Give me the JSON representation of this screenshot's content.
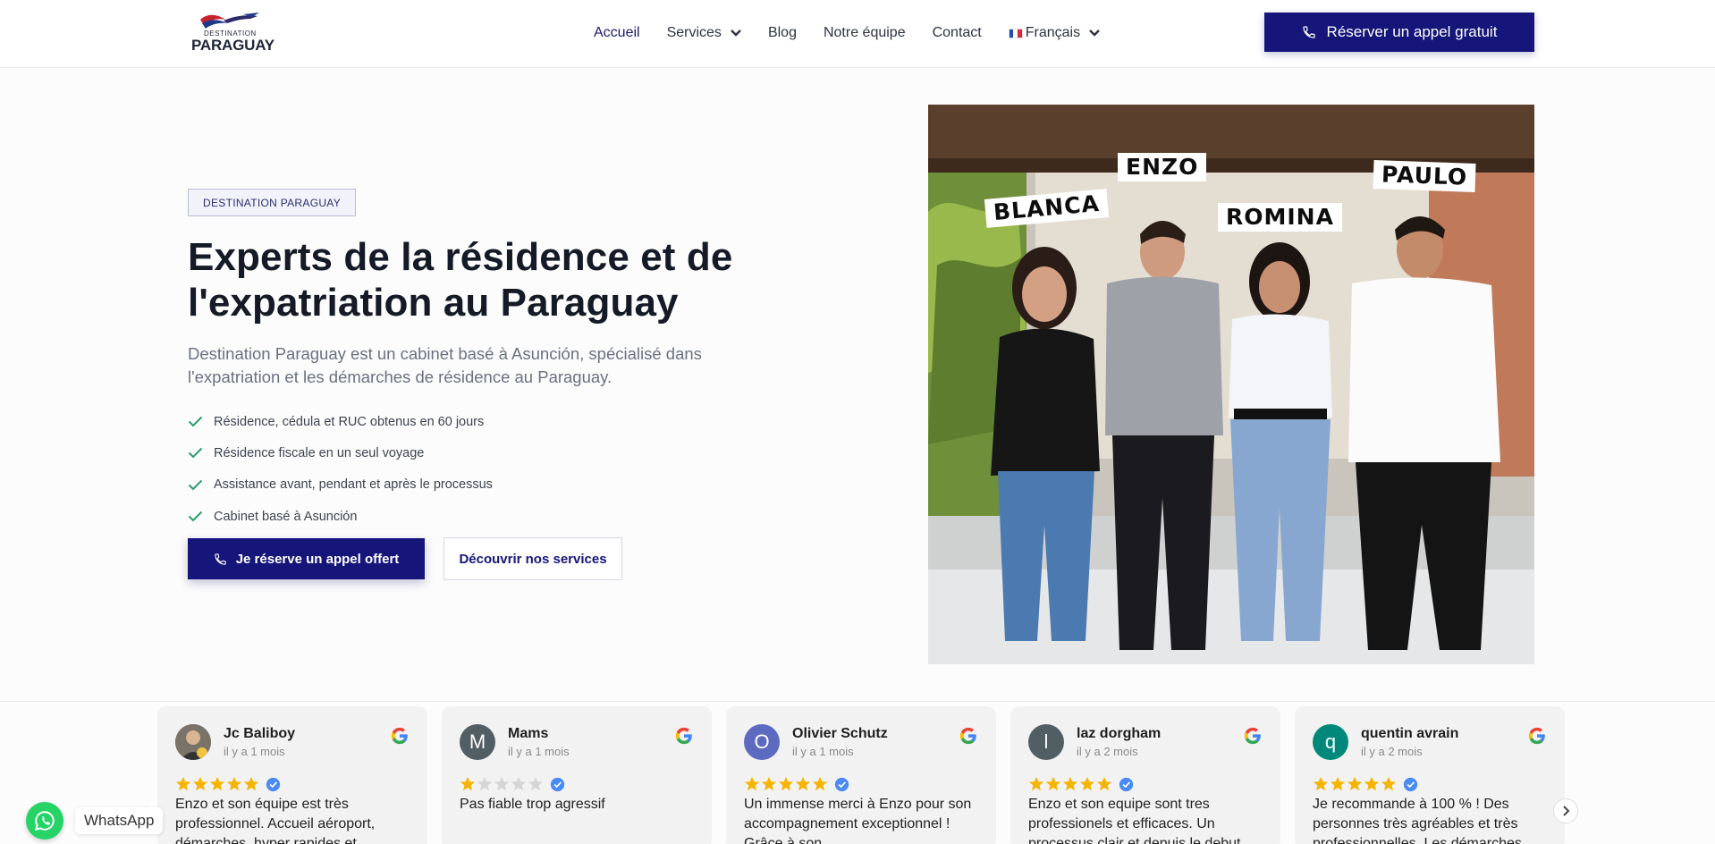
{
  "header": {
    "logo": {
      "line1": "DESTINATION",
      "line2": "PARAGUAY"
    },
    "nav": [
      {
        "label": "Accueil",
        "active": true
      },
      {
        "label": "Services",
        "dropdown": true
      },
      {
        "label": "Blog"
      },
      {
        "label": "Notre équipe"
      },
      {
        "label": "Contact"
      },
      {
        "label": "Français",
        "dropdown": true,
        "flag": "france-flag-icon"
      }
    ],
    "cta_label": "Réserver un appel gratuit"
  },
  "hero": {
    "badge": "DESTINATION PARAGUAY",
    "title": "Experts de la résidence et de l'expatriation au Paraguay",
    "subtitle": "Destination Paraguay est un cabinet basé à Asunción, spécialisé dans l'expatriation et les démarches de résidence au Paraguay.",
    "checklist": [
      "Résidence, cédula et RUC obtenus en 60 jours",
      "Résidence fiscale en un seul voyage",
      "Assistance avant, pendant et après le processus",
      "Cabinet basé à Asunción"
    ],
    "primary_button": "Je réserve un appel offert",
    "secondary_button": "Découvrir nos services"
  },
  "team_photo": {
    "names": [
      "BLANCA",
      "ENZO",
      "ROMINA",
      "PAULO"
    ]
  },
  "reviews": [
    {
      "name": "Jc Baliboy",
      "date": "il y a 1 mois",
      "rating": 5,
      "avatar": "photo",
      "text": "Enzo et son équipe est très professionnel. Accueil aéroport, démarches, hyper rapides et"
    },
    {
      "name": "Mams",
      "date": "il y a 1 mois",
      "rating": 1,
      "avatar": "M",
      "text": "Pas fiable trop agressif"
    },
    {
      "name": "Olivier Schutz",
      "date": "il y a 1 mois",
      "rating": 5,
      "avatar": "O",
      "text": "Un immense merci à Enzo pour son accompagnement exceptionnel ! Grâce à son"
    },
    {
      "name": "laz dorgham",
      "date": "il y a 2 mois",
      "rating": 5,
      "avatar": "l",
      "text": "Enzo et son equipe sont tres professionels et efficaces. Un processus clair et depuis le debut"
    },
    {
      "name": "quentin avrain",
      "date": "il y a 2 mois",
      "rating": 5,
      "avatar": "q",
      "text": "Je recommande à 100 % ! Des personnes très agréables et très professionnelles. Les démarches"
    }
  ],
  "colors": {
    "brand": "#15157a",
    "check": "#2a9d6a",
    "star": "#f5b400",
    "whatsapp": "#25d366",
    "avatars": [
      "#6b6b6b",
      "#515e63",
      "#5c6bc0",
      "#515e63",
      "#00897b"
    ]
  },
  "whatsapp": {
    "label": "WhatsApp"
  }
}
